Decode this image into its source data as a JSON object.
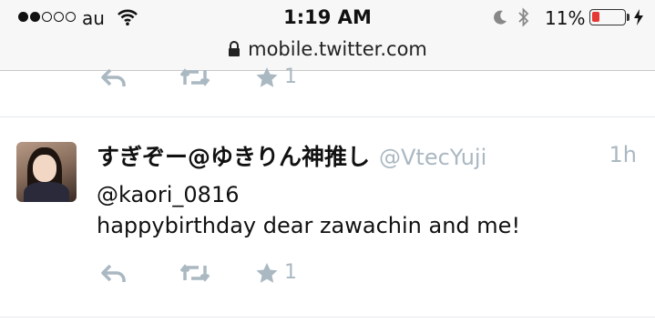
{
  "status_bar": {
    "carrier": "au",
    "signal_filled": 2,
    "signal_total": 5,
    "time": "1:19 AM",
    "battery_percent": "11%",
    "battery_level": 0.11,
    "battery_color": "#e53935"
  },
  "browser": {
    "url": "mobile.twitter.com"
  },
  "colors": {
    "muted": "#aab8c2",
    "divider": "#e1e8ed"
  },
  "partial_tweet": {
    "favorite_count": "1"
  },
  "tweet": {
    "display_name": "すぎぞー@ゆきりん神推し",
    "handle": "@VtecYuji",
    "timestamp": "1h",
    "mention": "@kaori_0816",
    "text": "happybirthday dear zawachin and me!",
    "favorite_count": "1"
  }
}
